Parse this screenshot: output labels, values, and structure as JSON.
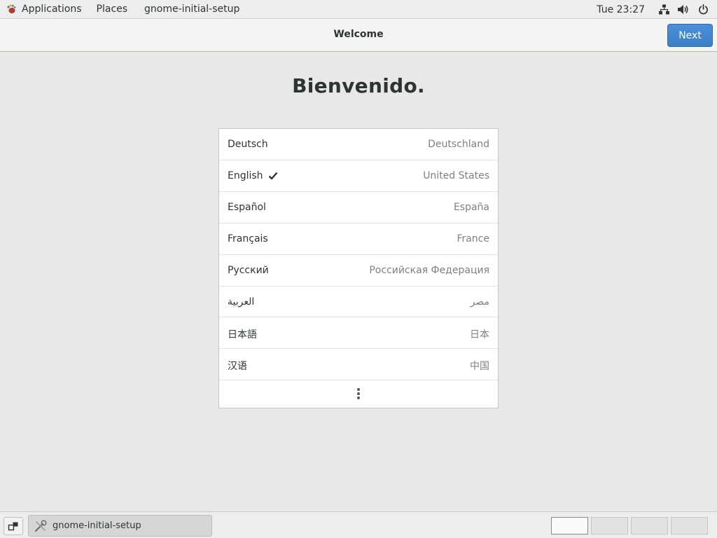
{
  "top_panel": {
    "applications_label": "Applications",
    "places_label": "Places",
    "active_app_label": "gnome-initial-setup",
    "clock": "Tue 23:27"
  },
  "header": {
    "title": "Welcome",
    "next_label": "Next"
  },
  "heading": "Bienvenido.",
  "languages": [
    {
      "name": "Deutsch",
      "region": "Deutschland"
    },
    {
      "name": "English",
      "region": "United States",
      "selected": true
    },
    {
      "name": "Español",
      "region": "España"
    },
    {
      "name": "Français",
      "region": "France"
    },
    {
      "name": "Русский",
      "region": "Российская Федерация"
    },
    {
      "name": "العربية",
      "region": "مصر"
    },
    {
      "name": "日本語",
      "region": "日本"
    },
    {
      "name": "汉语",
      "region": "中国"
    }
  ],
  "bottom_panel": {
    "task_label": "gnome-initial-setup",
    "workspaces": [
      {
        "active": true
      },
      {
        "active": false
      },
      {
        "active": false
      },
      {
        "active": false
      }
    ]
  },
  "icons": {
    "applications": "gnome-foot-icon",
    "network": "network-wired-icon",
    "volume": "speaker-volume-icon",
    "power": "power-icon",
    "check": "checkmark-icon",
    "more": "vertical-ellipsis-icon",
    "show_desktop": "show-desktop-icon",
    "task": "settings-tools-icon"
  },
  "colors": {
    "accent": "#3c7fc7",
    "background": "#e8e8e7"
  }
}
